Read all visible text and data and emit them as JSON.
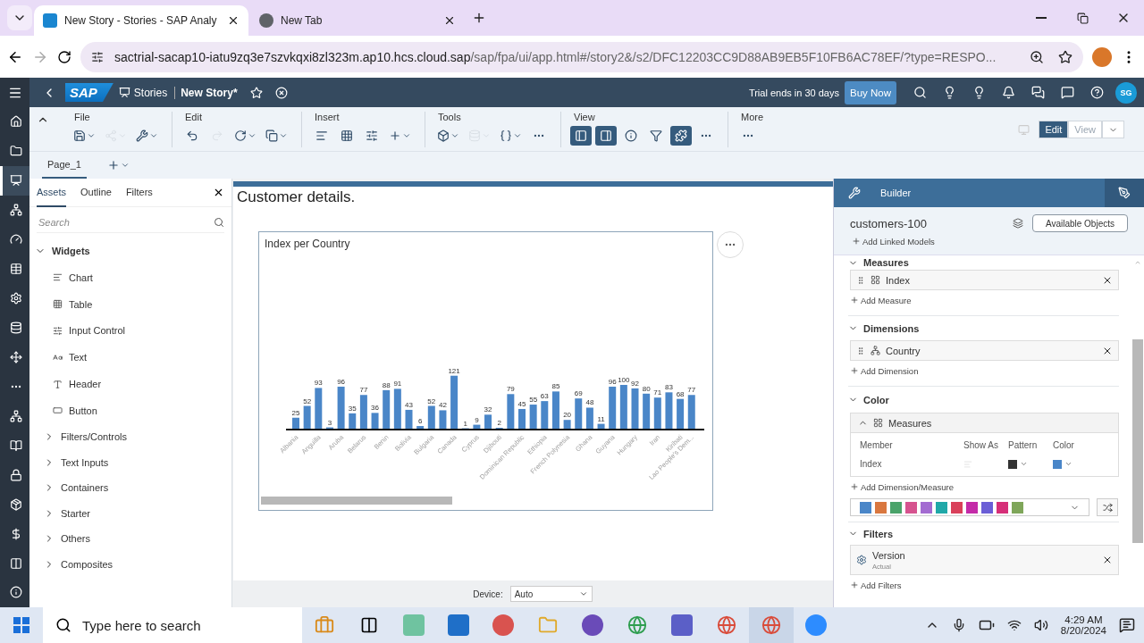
{
  "browser": {
    "tabs": [
      {
        "title": "New Story - Stories - SAP Analy",
        "selected": true
      },
      {
        "title": "New Tab",
        "selected": false
      }
    ],
    "url_host": "sactrial-sacap10-iatu9zq3e7szvkqxi8zl323m.ap10.hcs.cloud.sap",
    "url_path": "/sap/fpa/ui/app.html#/story2&/s2/DFC12203CC9D88AB9EB5F10FB6AC78EF/?type=RESPO..."
  },
  "shell": {
    "logo": "SAP",
    "breadcrumb": "Stories",
    "title": "New Story*",
    "trial": "Trial ends in 30 days",
    "buy": "Buy Now",
    "avatar": "SG"
  },
  "nav_rail": [
    {
      "selected": false
    },
    {
      "selected": false
    },
    {
      "selected": true
    },
    {
      "selected": false
    },
    {
      "selected": false
    },
    {
      "selected": false
    },
    {
      "selected": false
    },
    {
      "selected": false
    },
    {
      "selected": false
    },
    {
      "selected": false
    },
    {
      "selected": false
    },
    {
      "selected": false
    },
    {
      "selected": false
    },
    {
      "selected": false
    },
    {
      "selected": false
    },
    {
      "selected": false
    },
    {
      "selected": false
    }
  ],
  "toolbar": {
    "groups": [
      {
        "label": "File",
        "items": [
          {
            "kind": "save",
            "caret": true,
            "disabled": false
          },
          {
            "kind": "share",
            "caret": true,
            "disabled": true
          },
          {
            "kind": "tools",
            "caret": true,
            "disabled": false
          }
        ]
      },
      {
        "label": "Edit",
        "items": [
          {
            "kind": "undo",
            "caret": false,
            "disabled": false
          },
          {
            "kind": "redo",
            "caret": false,
            "disabled": true
          },
          {
            "kind": "refresh",
            "caret": true,
            "disabled": false
          },
          {
            "kind": "copy",
            "caret": true,
            "disabled": false
          }
        ]
      },
      {
        "label": "Insert",
        "items": [
          {
            "kind": "chart",
            "caret": false,
            "disabled": false
          },
          {
            "kind": "table",
            "caret": false,
            "disabled": false
          },
          {
            "kind": "input",
            "caret": false,
            "disabled": false
          },
          {
            "kind": "add",
            "caret": true,
            "disabled": false
          }
        ]
      },
      {
        "label": "Tools",
        "items": [
          {
            "kind": "model",
            "caret": true,
            "disabled": false
          },
          {
            "kind": "data",
            "caret": true,
            "disabled": true
          },
          {
            "kind": "formula",
            "caret": true,
            "disabled": false
          },
          {
            "kind": "more",
            "caret": false,
            "disabled": false
          }
        ]
      },
      {
        "label": "View",
        "items": [
          {
            "kind": "left-panel",
            "caret": false,
            "on": true
          },
          {
            "kind": "right-panel",
            "caret": false,
            "on": true
          },
          {
            "kind": "info",
            "caret": false,
            "on": false
          },
          {
            "kind": "filter",
            "caret": false,
            "on": false
          },
          {
            "kind": "builder",
            "caret": false,
            "on": true
          },
          {
            "kind": "more",
            "caret": false,
            "on": false
          }
        ]
      },
      {
        "label": "More",
        "items": [
          {
            "kind": "more",
            "caret": false,
            "disabled": false
          }
        ]
      }
    ],
    "modes": [
      {
        "label": "Edit",
        "selected": true
      },
      {
        "label": "View",
        "selected": false
      }
    ]
  },
  "pages": [
    {
      "label": "Page_1",
      "selected": true
    }
  ],
  "assets": {
    "tabs": [
      {
        "label": "Assets",
        "selected": true
      },
      {
        "label": "Outline",
        "selected": false
      },
      {
        "label": "Filters",
        "selected": false
      }
    ],
    "search": {
      "placeholder": "Search"
    },
    "tree": [
      {
        "label": "Widgets",
        "expanded": true,
        "children": [
          {
            "label": "Chart",
            "kind": "chart"
          },
          {
            "label": "Table",
            "kind": "table"
          },
          {
            "label": "Input Control",
            "kind": "input"
          },
          {
            "label": "Text",
            "kind": "text"
          },
          {
            "label": "Header",
            "kind": "header"
          },
          {
            "label": "Button",
            "kind": "button"
          }
        ]
      },
      {
        "label": "Filters/Controls",
        "expanded": false
      },
      {
        "label": "Text Inputs",
        "expanded": false
      },
      {
        "label": "Containers",
        "expanded": false
      },
      {
        "label": "Starter",
        "expanded": false
      },
      {
        "label": "Others",
        "expanded": false
      },
      {
        "label": "Composites",
        "expanded": false
      }
    ]
  },
  "canvas": {
    "heading": "Customer details.",
    "chart": {
      "chart_data": {
        "type": "bar",
        "title": "Index per Country",
        "categories": [
          "Albania",
          null,
          "Anguilla",
          null,
          "Aruba",
          null,
          "Belarus",
          null,
          "Benin",
          null,
          "Bolivia",
          null,
          "Bulgaria",
          null,
          "Canada",
          null,
          "Cyprus",
          null,
          "Djibouti",
          null,
          "Dominican Republic",
          null,
          "Ethiopia",
          null,
          "French Polynesia",
          null,
          "Ghana",
          null,
          "Guyana",
          null,
          "Hungary",
          null,
          "Iran",
          null,
          "Kiribati",
          "Lao People's Dem..."
        ],
        "series": [
          {
            "color": "#4a86c8",
            "values": [
              25,
              52,
              93,
              3,
              96,
              35,
              77,
              36,
              88,
              91,
              43,
              6,
              52,
              42,
              121,
              1,
              9,
              32,
              2,
              79,
              45,
              55,
              63,
              85,
              20,
              69,
              48,
              11,
              96,
              100,
              92,
              80,
              71,
              83,
              68,
              77
            ]
          }
        ],
        "data_labels": true
      }
    }
  },
  "device": {
    "label": "Device:",
    "value": "Auto"
  },
  "builder": {
    "title": "Builder",
    "model": "customers-100",
    "available": "Available Objects",
    "add_linked": "Add Linked Models",
    "measures": {
      "label": "Measures",
      "expanded": true,
      "items": [
        {
          "label": "Index"
        }
      ],
      "add": "Add Measure"
    },
    "dimensions": {
      "label": "Dimensions",
      "expanded": true,
      "items": [
        {
          "label": "Country"
        }
      ],
      "add": "Add Dimension"
    },
    "color": {
      "label": "Color",
      "expanded": true,
      "group": {
        "label": "Measures",
        "expanded": true,
        "columns": [
          "Member",
          "Show As",
          "Pattern",
          "Color"
        ],
        "rows": [
          {
            "member": "Index",
            "color": "#4a86c8"
          }
        ]
      },
      "add": "Add Dimension/Measure",
      "palette": [
        {
          "color": "#4a86c8"
        },
        {
          "color": "#d9773f"
        },
        {
          "color": "#4aa36a"
        },
        {
          "color": "#d6538f"
        },
        {
          "color": "#a36bd1"
        },
        {
          "color": "#20a8a8"
        },
        {
          "color": "#d9405a"
        },
        {
          "color": "#c42ba8"
        },
        {
          "color": "#6b5ed6"
        },
        {
          "color": "#d62f78"
        },
        {
          "color": "#7fa65a"
        }
      ]
    },
    "filters": {
      "label": "Filters",
      "expanded": true,
      "items": [
        {
          "label": "Version",
          "value": "Actual"
        }
      ],
      "add": "Add Filters"
    }
  },
  "taskbar": {
    "search": {
      "placeholder": "Type here to search"
    },
    "time": "4:29 AM",
    "date": "8/20/2024"
  }
}
